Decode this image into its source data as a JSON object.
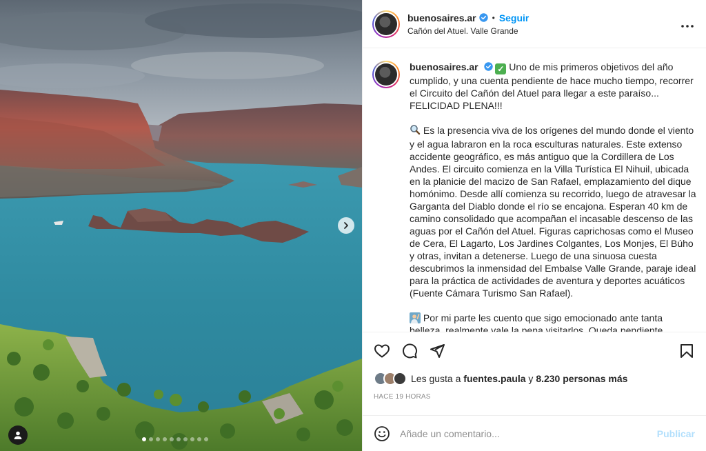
{
  "colors": {
    "accent": "#0095f6",
    "verified": "#3897f0",
    "muted": "#8e8e8e",
    "publish_disabled": "#b2dffc"
  },
  "header": {
    "username": "buenosaires.ar",
    "separator": "•",
    "follow_label": "Seguir",
    "location": "Cañón del Atuel. Valle Grande",
    "more_icon": "more-options-icon"
  },
  "media": {
    "next_icon": "chevron-right-icon",
    "tag_icon": "user-tag-icon",
    "carousel_count": 10,
    "carousel_active": 1
  },
  "caption": {
    "username": "buenosaires.ar",
    "paragraph1": "Uno de mis primeros objetivos del año cumplido, y una cuenta pendiente de hace mucho tiempo, recorrer el Circuito del Cañón del Atuel para llegar a este paraíso... FELICIDAD PLENA!!!",
    "paragraph2": "Es la presencia viva de los orígenes del mundo donde el viento y el agua labraron en la roca esculturas naturales. Este extenso accidente geográfico, es más antiguo que la Cordillera de Los Andes. El circuito comienza en la Villa Turística El Nihuil, ubicada en la planicie del macizo de San Rafael, emplazamiento del dique homónimo. Desde allí comienza su recorrido, luego de atravesar la Garganta del Diablo donde el río se encajona. Esperan 40 km de camino consolidado que acompañan el incasable descenso de las aguas por el Cañón del Atuel. Figuras caprichosas como el Museo de Cera, El Lagarto, Los Jardines Colgantes, Los Monjes, El Búho y otras, invitan a detenerse. Luego de una sinuosa cuesta descubrimos la inmensidad del Embalse Valle Grande,  paraje ideal para la práctica de actividades de aventura y deportes acuáticos (Fuente Cámara Turismo San Rafael).",
    "paragraph3": "Por mi parte les cuento que sigo emocionado ante tanta belleza, realmente vale la pena visitarlos. Queda pendiente"
  },
  "actions": {
    "like_icon": "heart-icon",
    "comment_icon": "comment-icon",
    "share_icon": "share-icon",
    "save_icon": "bookmark-icon"
  },
  "likes": {
    "prefix": "Les gusta a",
    "user": "fuentes.paula",
    "connector": "y",
    "others": "8.230 personas más"
  },
  "time": "HACE 19 HORAS",
  "comment": {
    "placeholder": "Añade un comentario...",
    "publish_label": "Publicar",
    "emoji_icon": "emoji-smile-icon"
  }
}
